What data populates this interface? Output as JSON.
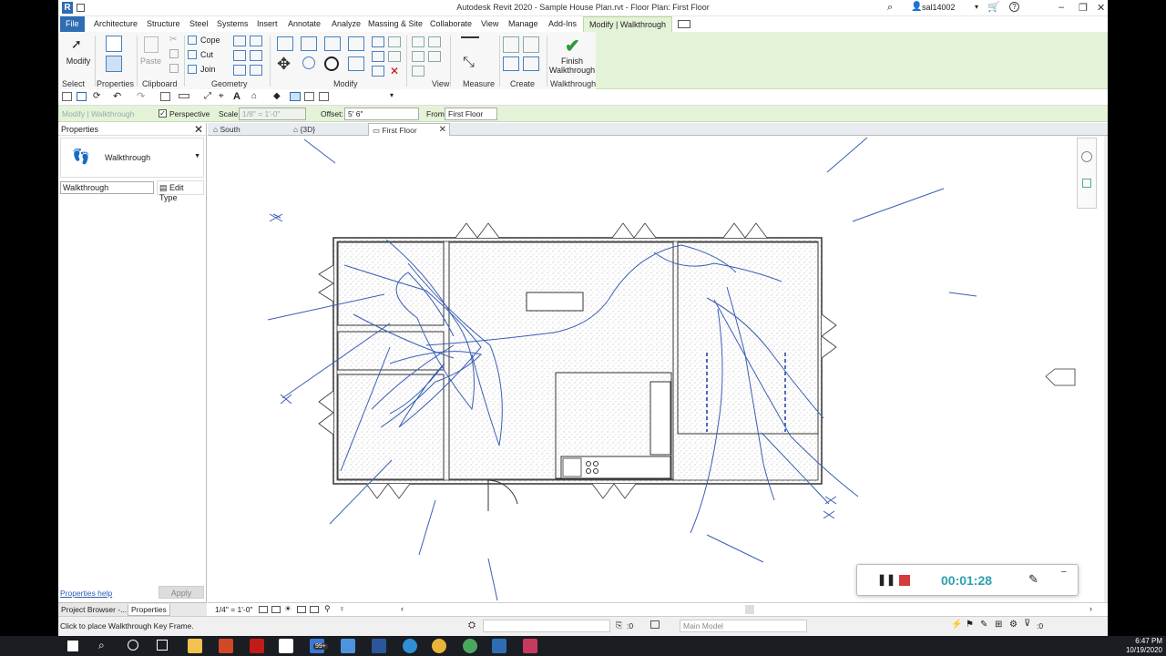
{
  "window": {
    "title": "Autodesk Revit 2020 - Sample House Plan.rvt - Floor Plan: First Floor",
    "user": "sal14002"
  },
  "ribbon_tabs": [
    "File",
    "Architecture",
    "Structure",
    "Steel",
    "Systems",
    "Insert",
    "Annotate",
    "Analyze",
    "Massing & Site",
    "Collaborate",
    "View",
    "Manage",
    "Add-Ins",
    "Modify | Walkthrough"
  ],
  "ribbon": {
    "modify_label": "Modify",
    "properties_label": "Properties",
    "paste_label": "Paste",
    "cope_label": "Cope",
    "cut_label": "Cut",
    "join_label": "Join",
    "finish_label_1": "Finish",
    "finish_label_2": "Walkthrough",
    "panels": [
      "Select",
      "Properties",
      "Clipboard",
      "Geometry",
      "Modify",
      "View",
      "Measure",
      "Create",
      "Walkthrough"
    ]
  },
  "options_bar": {
    "context": "Modify | Walkthrough",
    "perspective_label": "Perspective",
    "scale_label": "Scale:",
    "scale_value": "1/8\" = 1'-0\"",
    "offset_label": "Offset:",
    "offset_value": "5'  6\"",
    "from_label": "From",
    "from_value": "First Floor"
  },
  "properties": {
    "title": "Properties",
    "type_name": "Walkthrough",
    "instance_filter": "Walkthrough",
    "edit_type": "Edit Type",
    "help": "Properties help",
    "apply": "Apply"
  },
  "bottom_tabs": [
    "Project Browser -...",
    "Properties"
  ],
  "view_tabs": [
    "South",
    "{3D}",
    "First Floor"
  ],
  "view_bar": {
    "scale": "1/4\" = 1'-0\""
  },
  "status": {
    "message": "Click to place Walkthrough Key Frame.",
    "zero": ":0",
    "model": "Main Model",
    "filter": ":0"
  },
  "recorder": {
    "time": "00:01:28"
  },
  "taskbar": {
    "badge": "99+",
    "time": "6:47 PM",
    "date": "10/19/2020"
  },
  "colors": {
    "accent": "#2e6db4",
    "ribbon_green": "#e4f3d8",
    "path": "#3a5fb4",
    "timer": "#2f9fb0"
  }
}
